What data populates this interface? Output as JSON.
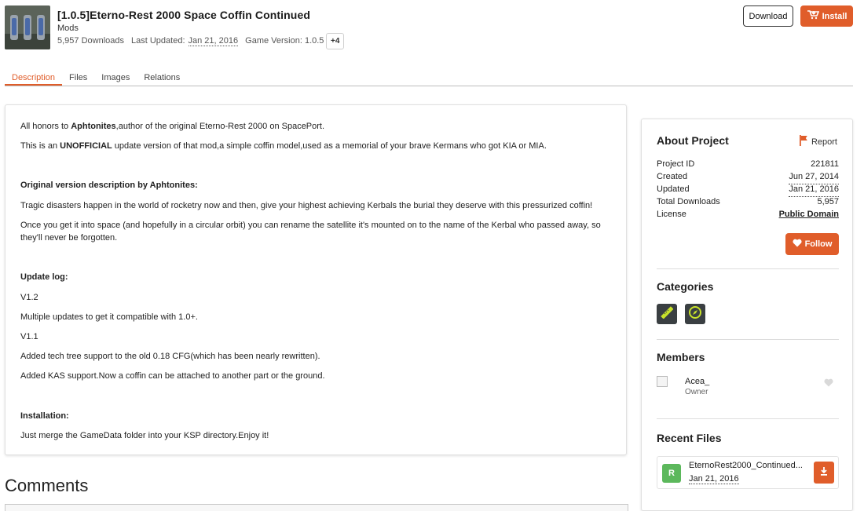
{
  "header": {
    "title": "[1.0.5]Eterno-Rest 2000 Space Coffin Continued",
    "category": "Mods",
    "downloads": "5,957 Downloads",
    "last_updated_label": "Last Updated:",
    "last_updated": "Jan 21, 2016",
    "game_version": "Game Version: 1.0.5",
    "more_versions": "+4",
    "download_label": "Download",
    "install_label": "Install"
  },
  "tabs": [
    {
      "label": "Description",
      "active": true
    },
    {
      "label": "Files"
    },
    {
      "label": "Images"
    },
    {
      "label": "Relations"
    }
  ],
  "description": {
    "p1_pre": "All honors to ",
    "p1_bold": "Aphtonites",
    "p1_post": ",author of the original Eterno-Rest 2000 on SpacePort.",
    "p2_pre": "This is an ",
    "p2_bold": "UNOFFICIAL",
    "p2_post": " update version of that mod,a simple coffin model,used as a memorial of your brave Kermans who got KIA or MIA.",
    "h_original": "Original version description by Aphtonites:",
    "p3": "Tragic disasters happen in the world of rocketry now and then, give your highest achieving Kerbals the burial they deserve with this pressurized coffin!",
    "p4": "Once you get it into space (and hopefully in a circular orbit) you can rename the satellite it's mounted on to the name of the Kerbal who passed away, so they'll never be forgotten.",
    "h_update": "Update log:",
    "v12": "V1.2",
    "v12_text": "Multiple updates to get it compatible with 1.0+.",
    "v11": "V1.1",
    "v11_text1": "Added tech tree support to the old 0.18 CFG(which has been nearly rewritten).",
    "v11_text2": "Added KAS support.Now a coffin can be attached to another part or the ground.",
    "h_install": "Installation:",
    "install_text": "Just merge the GameData folder into your KSP directory.Enjoy it!"
  },
  "comments": {
    "heading": "Comments"
  },
  "sidebar": {
    "about_title": "About Project",
    "report_label": "Report",
    "about": [
      {
        "label": "Project ID",
        "value": "221811"
      },
      {
        "label": "Created",
        "value": "Jun 27, 2014"
      },
      {
        "label": "Updated",
        "value": "Jan 21, 2016"
      },
      {
        "label": "Total Downloads",
        "value": "5,957"
      },
      {
        "label": "License",
        "value": "Public Domain"
      }
    ],
    "follow_label": "Follow",
    "categories_title": "Categories",
    "categories": [
      {
        "icon": "ruler-icon"
      },
      {
        "icon": "compass-icon"
      }
    ],
    "members_title": "Members",
    "member": {
      "name": "Acea_",
      "role": "Owner"
    },
    "recent_files_title": "Recent Files",
    "file": {
      "badge": "R",
      "name": "EternoRest2000_Continued...",
      "date": "Jan 21, 2016"
    }
  },
  "colors": {
    "accent": "#e05d2a",
    "release_badge": "#5cb85c",
    "category_icon_bg": "#3a3f42",
    "category_icon_fg": "#c8e22a"
  }
}
